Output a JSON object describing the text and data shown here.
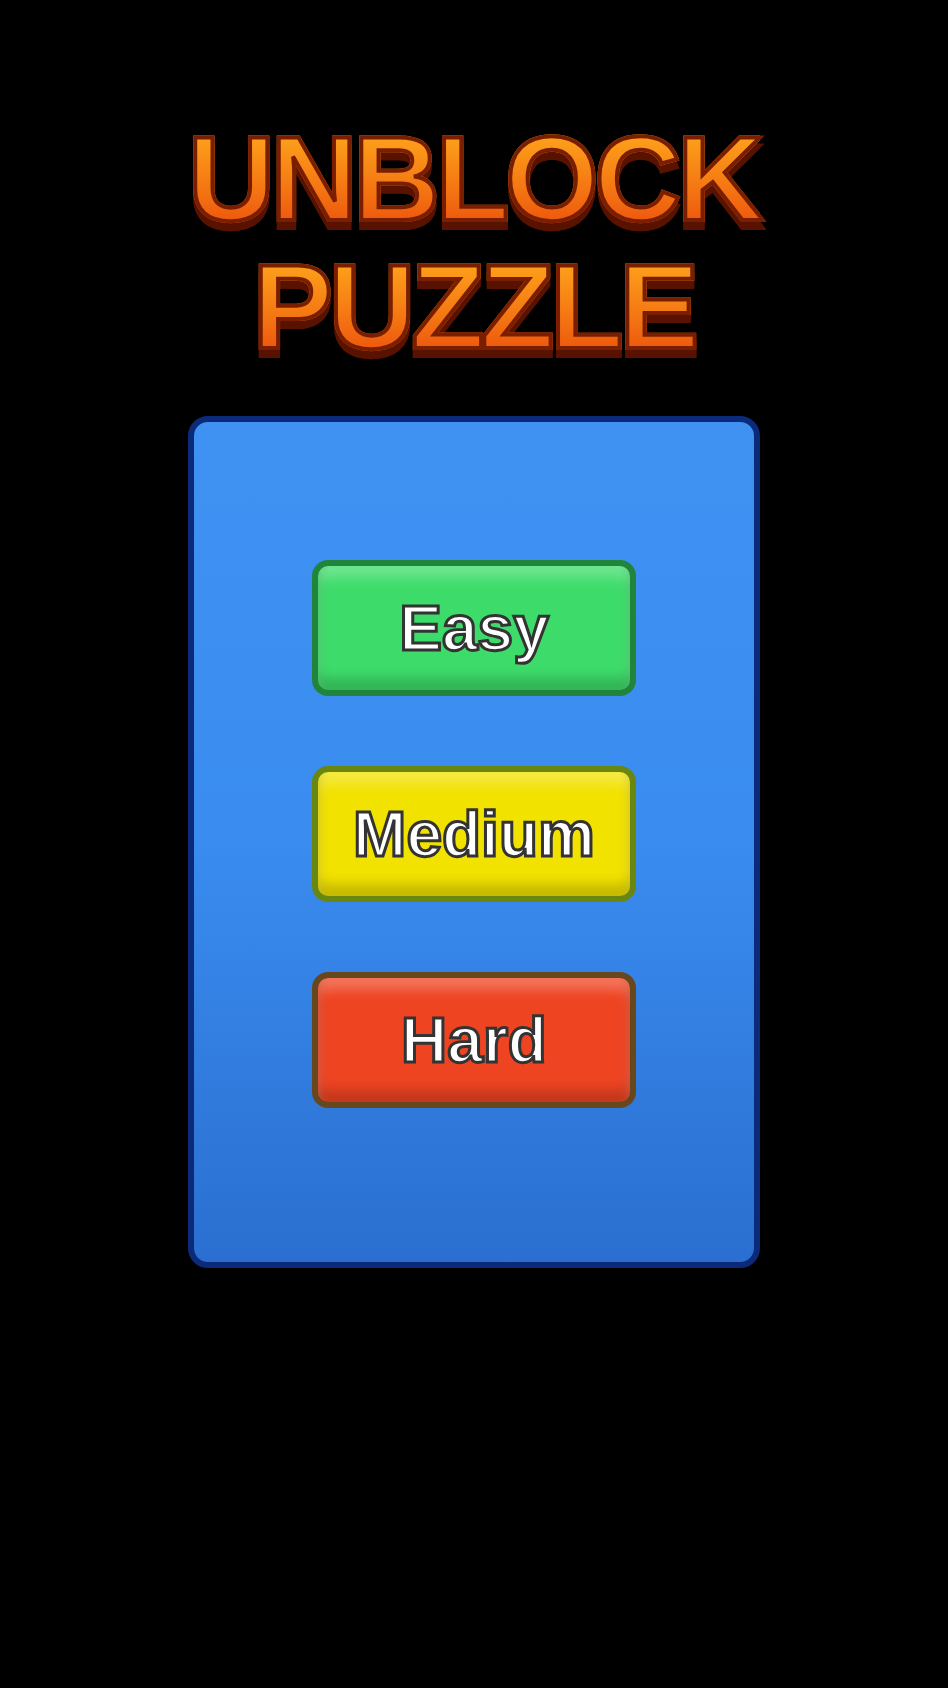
{
  "title": {
    "lines": [
      "UNBLOCK",
      "PUZZLE"
    ]
  },
  "buttons": [
    {
      "label": "Easy",
      "color": "#3ddc6a"
    },
    {
      "label": "Medium",
      "color": "#f2e200"
    },
    {
      "label": "Hard",
      "color": "#ee4422"
    }
  ]
}
